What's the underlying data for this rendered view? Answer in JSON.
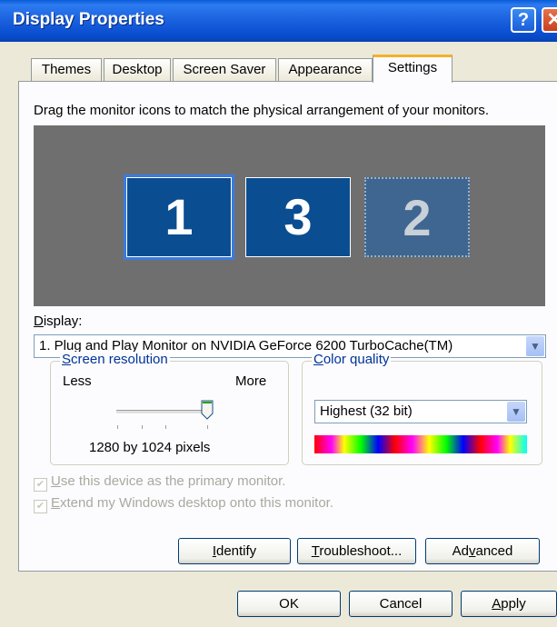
{
  "window": {
    "title": "Display Properties",
    "help_glyph": "?",
    "close_glyph": "✕"
  },
  "tabs": [
    {
      "label": "Themes"
    },
    {
      "label": "Desktop"
    },
    {
      "label": "Screen Saver"
    },
    {
      "label": "Appearance"
    },
    {
      "label": "Settings",
      "active": true
    }
  ],
  "settings": {
    "instruction": "Drag the monitor icons to match the physical arrangement of your monitors.",
    "monitors": [
      {
        "number": "1",
        "selected": true,
        "active": true
      },
      {
        "number": "3",
        "selected": false,
        "active": true
      },
      {
        "number": "2",
        "selected": false,
        "active": false
      }
    ],
    "display_label_accel": "D",
    "display_label_rest": "isplay:",
    "display_value": "1. Plug and Play Monitor on NVIDIA GeForce 6200 TurboCache(TM)",
    "resolution": {
      "legend_accel": "S",
      "legend_rest": "creen resolution",
      "less_label": "Less",
      "more_label": "More",
      "slider_level": 1.0,
      "value_text": "1280 by 1024 pixels"
    },
    "color_quality": {
      "legend_accel": "C",
      "legend_rest": "olor quality",
      "selected": "Highest (32 bit)"
    },
    "checkboxes": [
      {
        "accel": "U",
        "rest": "se this device as the primary monitor.",
        "checked": true,
        "enabled": false
      },
      {
        "accel": "E",
        "rest": "xtend my Windows desktop onto this monitor.",
        "checked": true,
        "enabled": false
      }
    ],
    "buttons": {
      "identify": {
        "accel": "I",
        "rest": "dentify"
      },
      "troubleshoot": {
        "accel": "T",
        "rest": "roubleshoot..."
      },
      "advanced": {
        "pre": "Ad",
        "accel": "v",
        "rest": "anced"
      }
    }
  },
  "dialog_buttons": {
    "ok": "OK",
    "cancel": "Cancel",
    "apply": {
      "accel": "A",
      "rest": "pply"
    }
  },
  "colors": {
    "title_bar": "#0a4fd0",
    "monitor_fill": "#0b4d91",
    "arrangement_bg": "#6f6f6f",
    "tab_highlight": "#f5b02b"
  }
}
